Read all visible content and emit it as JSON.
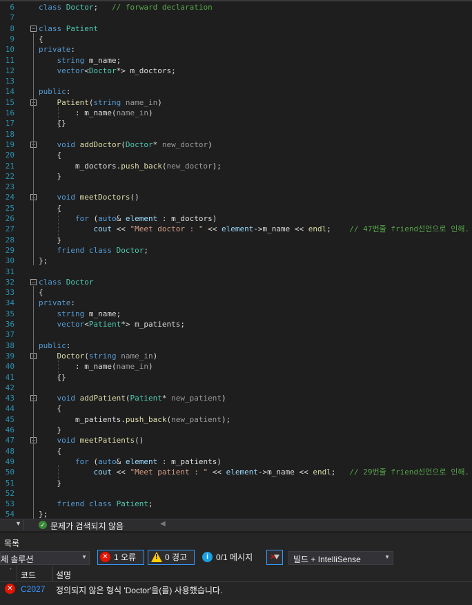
{
  "editor": {
    "lines": [
      {
        "n": "6",
        "fold": "",
        "tokens": [
          [
            "kw",
            "class "
          ],
          [
            "cls",
            "Doctor"
          ],
          [
            "ns",
            ";   "
          ],
          [
            "cm",
            "// forward declaration"
          ]
        ]
      },
      {
        "n": "7",
        "fold": "",
        "tokens": []
      },
      {
        "n": "8",
        "fold": "minus",
        "tokens": [
          [
            "kw",
            "class "
          ],
          [
            "cls",
            "Patient"
          ]
        ]
      },
      {
        "n": "9",
        "fold": "",
        "tokens": [
          [
            "ns",
            "{"
          ]
        ]
      },
      {
        "n": "10",
        "fold": "",
        "tokens": [
          [
            "kw",
            "private"
          ],
          [
            "ns",
            ":"
          ]
        ]
      },
      {
        "n": "11",
        "fold": "",
        "tokens": [
          [
            "ns",
            "    "
          ],
          [
            "kw",
            "string "
          ],
          [
            "ns",
            "m_name;"
          ]
        ]
      },
      {
        "n": "12",
        "fold": "",
        "tokens": [
          [
            "ns",
            "    "
          ],
          [
            "kw",
            "vector"
          ],
          [
            "ns",
            "<"
          ],
          [
            "cls",
            "Doctor"
          ],
          [
            "ns",
            "*> m_doctors;"
          ]
        ]
      },
      {
        "n": "13",
        "fold": "",
        "tokens": []
      },
      {
        "n": "14",
        "fold": "",
        "tokens": [
          [
            "kw",
            "public"
          ],
          [
            "ns",
            ":"
          ]
        ]
      },
      {
        "n": "15",
        "fold": "minus",
        "tokens": [
          [
            "ns",
            "    "
          ],
          [
            "fn",
            "Patient"
          ],
          [
            "ns",
            "("
          ],
          [
            "kw",
            "string "
          ],
          [
            "prm",
            "name_in"
          ],
          [
            "ns",
            ")"
          ]
        ]
      },
      {
        "n": "16",
        "fold": "",
        "tokens": [
          [
            "ns",
            "        : m_name("
          ],
          [
            "prm",
            "name_in"
          ],
          [
            "ns",
            ")"
          ]
        ]
      },
      {
        "n": "17",
        "fold": "",
        "tokens": [
          [
            "ns",
            "    {}"
          ]
        ]
      },
      {
        "n": "18",
        "fold": "",
        "tokens": []
      },
      {
        "n": "19",
        "fold": "minus",
        "tokens": [
          [
            "ns",
            "    "
          ],
          [
            "kw",
            "void "
          ],
          [
            "fn",
            "addDoctor"
          ],
          [
            "ns",
            "("
          ],
          [
            "cls",
            "Doctor"
          ],
          [
            "ns",
            "* "
          ],
          [
            "prm",
            "new_doctor"
          ],
          [
            "ns",
            ")"
          ]
        ]
      },
      {
        "n": "20",
        "fold": "",
        "tokens": [
          [
            "ns",
            "    {"
          ]
        ]
      },
      {
        "n": "21",
        "fold": "",
        "tokens": [
          [
            "ns",
            "        m_doctors."
          ],
          [
            "fn",
            "push_back"
          ],
          [
            "ns",
            "("
          ],
          [
            "prm",
            "new_doctor"
          ],
          [
            "ns",
            ");"
          ]
        ]
      },
      {
        "n": "22",
        "fold": "",
        "tokens": [
          [
            "ns",
            "    }"
          ]
        ]
      },
      {
        "n": "23",
        "fold": "",
        "tokens": []
      },
      {
        "n": "24",
        "fold": "minus",
        "tokens": [
          [
            "ns",
            "    "
          ],
          [
            "kw",
            "void "
          ],
          [
            "fn",
            "meetDoctors"
          ],
          [
            "ns",
            "()"
          ]
        ]
      },
      {
        "n": "25",
        "fold": "",
        "tokens": [
          [
            "ns",
            "    {"
          ]
        ]
      },
      {
        "n": "26",
        "fold": "",
        "tokens": [
          [
            "ns",
            "        "
          ],
          [
            "kw",
            "for "
          ],
          [
            "ns",
            "("
          ],
          [
            "kw",
            "auto"
          ],
          [
            "ns",
            "& "
          ],
          [
            "var",
            "element"
          ],
          [
            "ns",
            " : m_doctors)"
          ]
        ]
      },
      {
        "n": "27",
        "fold": "",
        "tokens": [
          [
            "ns",
            "            "
          ],
          [
            "var",
            "cout"
          ],
          [
            "ns",
            " << "
          ],
          [
            "str",
            "\"Meet doctor : \""
          ],
          [
            "ns",
            " << "
          ],
          [
            "var",
            "element"
          ],
          [
            "ns",
            "->m_name << "
          ],
          [
            "fn",
            "endl"
          ],
          [
            "ns",
            ";    "
          ],
          [
            "cm",
            "// 47번줄 friend선언으로 인해."
          ]
        ]
      },
      {
        "n": "28",
        "fold": "",
        "tokens": [
          [
            "ns",
            "    }"
          ]
        ]
      },
      {
        "n": "29",
        "fold": "",
        "tokens": [
          [
            "ns",
            "    "
          ],
          [
            "kw",
            "friend class "
          ],
          [
            "cls",
            "Doctor"
          ],
          [
            "ns",
            ";"
          ]
        ]
      },
      {
        "n": "30",
        "fold": "",
        "tokens": [
          [
            "ns",
            "};"
          ]
        ]
      },
      {
        "n": "31",
        "fold": "",
        "tokens": []
      },
      {
        "n": "32",
        "fold": "minus",
        "tokens": [
          [
            "kw",
            "class "
          ],
          [
            "cls",
            "Doctor"
          ]
        ]
      },
      {
        "n": "33",
        "fold": "",
        "tokens": [
          [
            "ns",
            "{"
          ]
        ]
      },
      {
        "n": "34",
        "fold": "",
        "tokens": [
          [
            "kw",
            "private"
          ],
          [
            "ns",
            ":"
          ]
        ]
      },
      {
        "n": "35",
        "fold": "",
        "tokens": [
          [
            "ns",
            "    "
          ],
          [
            "kw",
            "string "
          ],
          [
            "ns",
            "m_name;"
          ]
        ]
      },
      {
        "n": "36",
        "fold": "",
        "tokens": [
          [
            "ns",
            "    "
          ],
          [
            "kw",
            "vector"
          ],
          [
            "ns",
            "<"
          ],
          [
            "cls",
            "Patient"
          ],
          [
            "ns",
            "*> m_patients;"
          ]
        ]
      },
      {
        "n": "37",
        "fold": "",
        "tokens": []
      },
      {
        "n": "38",
        "fold": "",
        "tokens": [
          [
            "kw",
            "public"
          ],
          [
            "ns",
            ":"
          ]
        ]
      },
      {
        "n": "39",
        "fold": "minus",
        "tokens": [
          [
            "ns",
            "    "
          ],
          [
            "fn",
            "Doctor"
          ],
          [
            "ns",
            "("
          ],
          [
            "kw",
            "string "
          ],
          [
            "prm",
            "name_in"
          ],
          [
            "ns",
            ")"
          ]
        ]
      },
      {
        "n": "40",
        "fold": "",
        "tokens": [
          [
            "ns",
            "        : m_name("
          ],
          [
            "prm",
            "name_in"
          ],
          [
            "ns",
            ")"
          ]
        ]
      },
      {
        "n": "41",
        "fold": "",
        "tokens": [
          [
            "ns",
            "    {}"
          ]
        ]
      },
      {
        "n": "42",
        "fold": "",
        "tokens": []
      },
      {
        "n": "43",
        "fold": "minus",
        "tokens": [
          [
            "ns",
            "    "
          ],
          [
            "kw",
            "void "
          ],
          [
            "fn",
            "addPatient"
          ],
          [
            "ns",
            "("
          ],
          [
            "cls",
            "Patient"
          ],
          [
            "ns",
            "* "
          ],
          [
            "prm",
            "new_patient"
          ],
          [
            "ns",
            ")"
          ]
        ]
      },
      {
        "n": "44",
        "fold": "",
        "tokens": [
          [
            "ns",
            "    {"
          ]
        ]
      },
      {
        "n": "45",
        "fold": "",
        "tokens": [
          [
            "ns",
            "        m_patients."
          ],
          [
            "fn",
            "push_back"
          ],
          [
            "ns",
            "("
          ],
          [
            "prm",
            "new_patient"
          ],
          [
            "ns",
            ");"
          ]
        ]
      },
      {
        "n": "46",
        "fold": "",
        "tokens": [
          [
            "ns",
            "    }"
          ]
        ]
      },
      {
        "n": "47",
        "fold": "minus",
        "tokens": [
          [
            "ns",
            "    "
          ],
          [
            "kw",
            "void "
          ],
          [
            "fn",
            "meetPatients"
          ],
          [
            "ns",
            "()"
          ]
        ]
      },
      {
        "n": "48",
        "fold": "",
        "tokens": [
          [
            "ns",
            "    {"
          ]
        ]
      },
      {
        "n": "49",
        "fold": "",
        "tokens": [
          [
            "ns",
            "        "
          ],
          [
            "kw",
            "for "
          ],
          [
            "ns",
            "("
          ],
          [
            "kw",
            "auto"
          ],
          [
            "ns",
            "& "
          ],
          [
            "var",
            "element"
          ],
          [
            "ns",
            " : m_patients)"
          ]
        ]
      },
      {
        "n": "50",
        "fold": "",
        "tokens": [
          [
            "ns",
            "            "
          ],
          [
            "var",
            "cout"
          ],
          [
            "ns",
            " << "
          ],
          [
            "str",
            "\"Meet patient : \""
          ],
          [
            "ns",
            " << "
          ],
          [
            "var",
            "element"
          ],
          [
            "ns",
            "->m_name << "
          ],
          [
            "fn",
            "endl"
          ],
          [
            "ns",
            ";   "
          ],
          [
            "cm",
            "// 29번줄 friend선언으로 인해."
          ]
        ]
      },
      {
        "n": "51",
        "fold": "",
        "tokens": [
          [
            "ns",
            "    }"
          ]
        ]
      },
      {
        "n": "52",
        "fold": "",
        "tokens": []
      },
      {
        "n": "53",
        "fold": "",
        "tokens": [
          [
            "ns",
            "    "
          ],
          [
            "kw",
            "friend class "
          ],
          [
            "cls",
            "Patient"
          ],
          [
            "ns",
            ";"
          ]
        ]
      },
      {
        "n": "54",
        "fold": "",
        "tokens": [
          [
            "ns",
            "};"
          ]
        ]
      }
    ]
  },
  "status": {
    "issues_text": "문제가 검색되지 않음"
  },
  "error_list": {
    "title": "목록",
    "scope_value": "체 솔루션",
    "errors_label": "1 오류",
    "warnings_label": "0 경고",
    "messages_label": "0/1 메시지",
    "build_filter": "빌드 + IntelliSense",
    "col_code": "코드",
    "col_desc": "설명",
    "rows": [
      {
        "code": "C2027",
        "desc": "정의되지 않은 형식 'Doctor'을(를) 사용했습니다."
      }
    ]
  },
  "colors": {
    "editor_bg": "#1e1e1e",
    "keyword": "#569cd6",
    "type": "#4ec9b0",
    "function": "#dcdcaa",
    "string": "#d69d85",
    "comment": "#57a64a",
    "line_number": "#2b91af",
    "error": "#e51400",
    "warning": "#ffcc00",
    "info": "#1ba1e2"
  }
}
